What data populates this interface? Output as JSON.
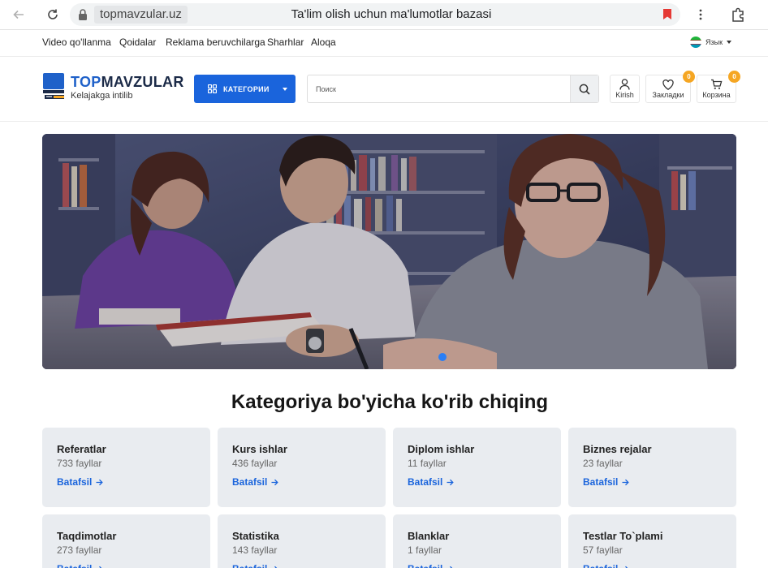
{
  "browser": {
    "url": "topmavzular.uz",
    "page_title": "Ta'lim olish uchun ma'lumotlar bazasi"
  },
  "toplinks": [
    {
      "label": "Video qo'llanma"
    },
    {
      "label": "Qoidalar"
    },
    {
      "label": "Reklama beruvchilarga"
    },
    {
      "label": "Sharhlar"
    },
    {
      "label": "Aloqa"
    }
  ],
  "language": {
    "label": "Язык",
    "flag_icon": "uzbekistan-flag-icon"
  },
  "header": {
    "logo_top": "TOP",
    "logo_rest": "MAVZULAR",
    "tagline": "Kelajakga intilib",
    "category_button": "КАТЕГОРИИ",
    "search_placeholder": "Поиск",
    "login_label": "Kirish",
    "bookmarks_label": "Закладки",
    "bookmarks_count": "0",
    "cart_label": "Корзина",
    "cart_count": "0"
  },
  "colors": {
    "brand_blue": "#1a64dc",
    "logo_dark": "#1b2a47",
    "badge_orange": "#f5a623",
    "card_bg": "#e9ecf0"
  },
  "categories": {
    "title": "Kategoriya bo'yicha ko'rib chiqing",
    "link_label": "Batafsil",
    "items": [
      {
        "name": "Referatlar",
        "count": "733 fayllar"
      },
      {
        "name": "Kurs ishlar",
        "count": "436 fayllar"
      },
      {
        "name": "Diplom ishlar",
        "count": "11 fayllar"
      },
      {
        "name": "Biznes rejalar",
        "count": "23 fayllar"
      },
      {
        "name": "Taqdimotlar",
        "count": "273 fayllar"
      },
      {
        "name": "Statistika",
        "count": "143 fayllar"
      },
      {
        "name": "Blanklar",
        "count": "1 fayllar"
      },
      {
        "name": "Testlar To`plami",
        "count": "57 fayllar"
      }
    ]
  }
}
